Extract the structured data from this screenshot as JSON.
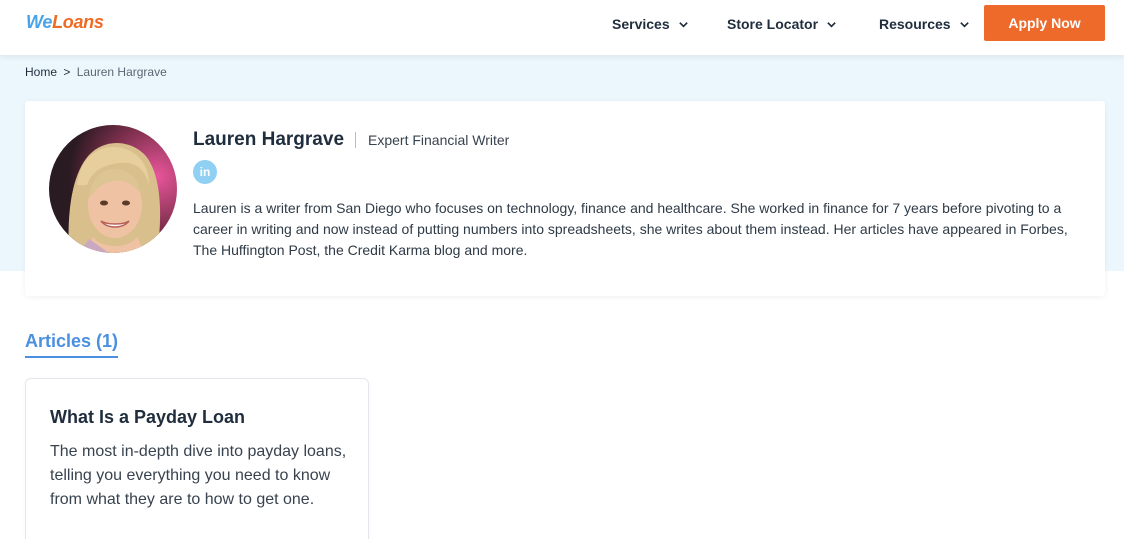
{
  "header": {
    "logo_we": "We",
    "logo_loans": "Loans",
    "nav": [
      {
        "label": "Services"
      },
      {
        "label": "Store Locator"
      },
      {
        "label": "Resources"
      }
    ],
    "apply_label": "Apply Now"
  },
  "breadcrumb": {
    "home": "Home",
    "separator": ">",
    "current": "Lauren Hargrave"
  },
  "author": {
    "name": "Lauren Hargrave",
    "role": "Expert Financial Writer",
    "linkedin_label": "in",
    "bio": "Lauren is a writer from San Diego who focuses on technology, finance and healthcare. She worked in finance for 7 years before pivoting to a career in writing and now instead of putting numbers into spreadsheets, she writes about them instead. Her articles have appeared in Forbes, The Huffington Post, the Credit Karma blog and more."
  },
  "articles": {
    "heading": "Articles (1)",
    "items": [
      {
        "title": "What Is a Payday Loan",
        "description": "The most in-depth dive into payday loans, telling you everything you need to know from what they are to how to get one."
      }
    ]
  },
  "colors": {
    "brand_blue": "#4aa3e8",
    "brand_orange": "#f06a22",
    "apply_button": "#ee6a2a",
    "hero_background": "#ecf7fd",
    "accent_link": "#4a8fe0",
    "linkedin_badge": "#8fd0f3"
  }
}
